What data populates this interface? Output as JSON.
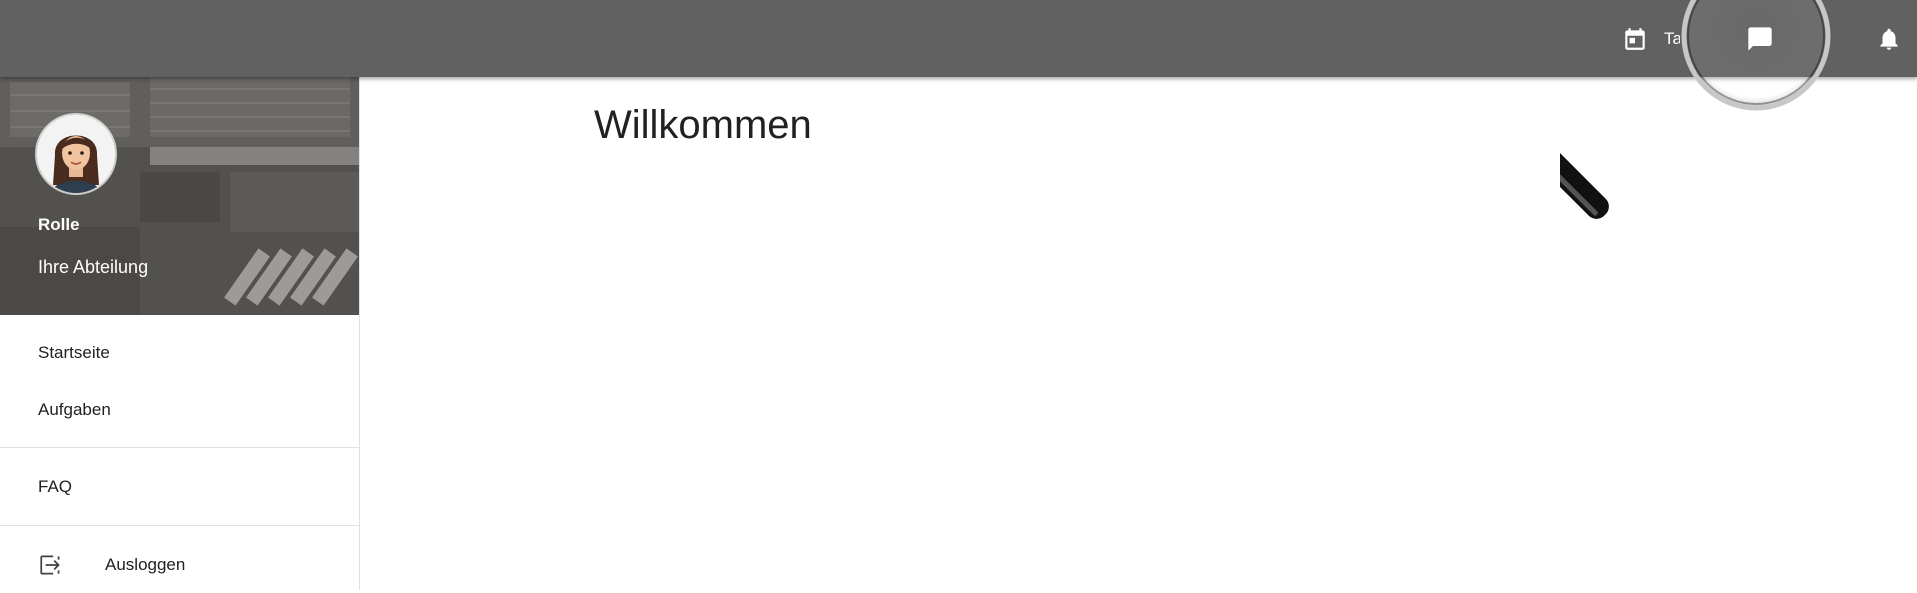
{
  "topbar": {
    "calendar_label": "Ta"
  },
  "profile": {
    "role": "Rolle",
    "department": "Ihre Abteilung"
  },
  "nav": {
    "items": [
      {
        "label": "Startseite"
      },
      {
        "label": "Aufgaben"
      }
    ],
    "faq_label": "FAQ",
    "logout_label": "Ausloggen"
  },
  "main": {
    "title": "Willkommen"
  },
  "icons": {
    "calendar": "calendar-icon",
    "chat": "chat-icon",
    "notifications": "bell-icon",
    "logout": "logout-icon"
  },
  "colors": {
    "topbar": "#616161",
    "text": "#212121",
    "divider": "#e0e0e0"
  }
}
